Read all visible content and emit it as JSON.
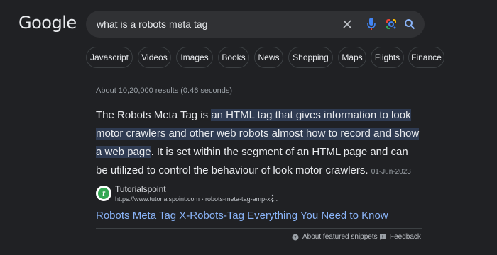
{
  "logo": "Google",
  "search": {
    "query": "what is a robots meta tag"
  },
  "chips": [
    "Javascript",
    "Videos",
    "Images",
    "Books",
    "News",
    "Shopping",
    "Maps",
    "Flights",
    "Finance"
  ],
  "stats": "About 10,20,000 results (0.46 seconds)",
  "snippet": {
    "part1": "The Robots Meta Tag is ",
    "highlight": "an HTML tag that gives information to look motor crawlers and other web robots almost how to record and show a web page",
    "part2": ". It is set within the segment of an HTML page and can be utilized to control the behaviour of look motor crawlers.",
    "date": "01-Jun-2023"
  },
  "source": {
    "name": "Tutorialspoint",
    "url": "https://www.tutorialspoint.com › robots-meta-tag-amp-x-...",
    "favicon_letter": "t"
  },
  "result": {
    "title": "Robots Meta Tag X-Robots-Tag Everything You Need to Know"
  },
  "footer": {
    "about": "About featured snippets",
    "feedback": "Feedback"
  },
  "colors": {
    "background": "#202124",
    "link": "#8ab4f8",
    "highlight": "#2f3b52",
    "mic_blue": "#4285f4",
    "mic_red": "#ea4335",
    "favicon_green": "#34a853"
  },
  "icons": [
    "close-icon",
    "microphone-icon",
    "google-lens-icon",
    "search-icon",
    "more-vert-icon",
    "help-icon",
    "feedback-icon"
  ]
}
